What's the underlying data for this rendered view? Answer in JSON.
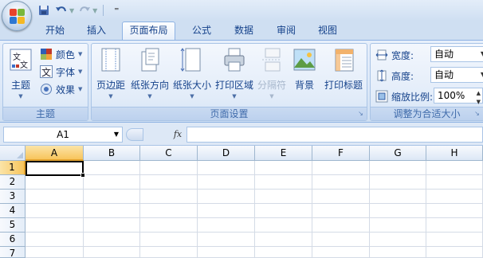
{
  "quick_access": {
    "icons": [
      "office-orb-icon",
      "save-icon",
      "undo-icon",
      "redo-icon",
      "customize-icon"
    ],
    "customize_glyph": "⁼"
  },
  "tabs": [
    {
      "label": "开始",
      "active": false
    },
    {
      "label": "插入",
      "active": false
    },
    {
      "label": "页面布局",
      "active": true
    },
    {
      "label": "公式",
      "active": false
    },
    {
      "label": "数据",
      "active": false
    },
    {
      "label": "审阅",
      "active": false
    },
    {
      "label": "视图",
      "active": false
    }
  ],
  "ribbon": {
    "theme_group": {
      "label": "主题",
      "themes_button": "主题",
      "colors_button": "颜色",
      "fonts_button": "字体",
      "effects_button": "效果"
    },
    "page_setup_group": {
      "label": "页面设置",
      "buttons": [
        {
          "label": "页边距",
          "disabled": false
        },
        {
          "label": "纸张方向",
          "disabled": false
        },
        {
          "label": "纸张大小",
          "disabled": false
        },
        {
          "label": "打印区域",
          "disabled": false
        },
        {
          "label": "分隔符",
          "disabled": true
        },
        {
          "label": "背景",
          "disabled": false
        },
        {
          "label": "打印标题",
          "disabled": false
        }
      ]
    },
    "scale_group": {
      "label": "调整为合适大小",
      "width_label": "宽度:",
      "width_value": "自动",
      "height_label": "高度:",
      "height_value": "自动",
      "scale_label": "缩放比例:",
      "scale_value": "100%"
    }
  },
  "formula_bar": {
    "name_box": "A1",
    "fx_label": "fx",
    "formula_value": ""
  },
  "sheet": {
    "columns": [
      "A",
      "B",
      "C",
      "D",
      "E",
      "F",
      "G",
      "H"
    ],
    "rows": [
      "1",
      "2",
      "3",
      "4",
      "5",
      "6",
      "7"
    ],
    "selected_cell": "A1",
    "header_highlight": "#f8c55c"
  }
}
